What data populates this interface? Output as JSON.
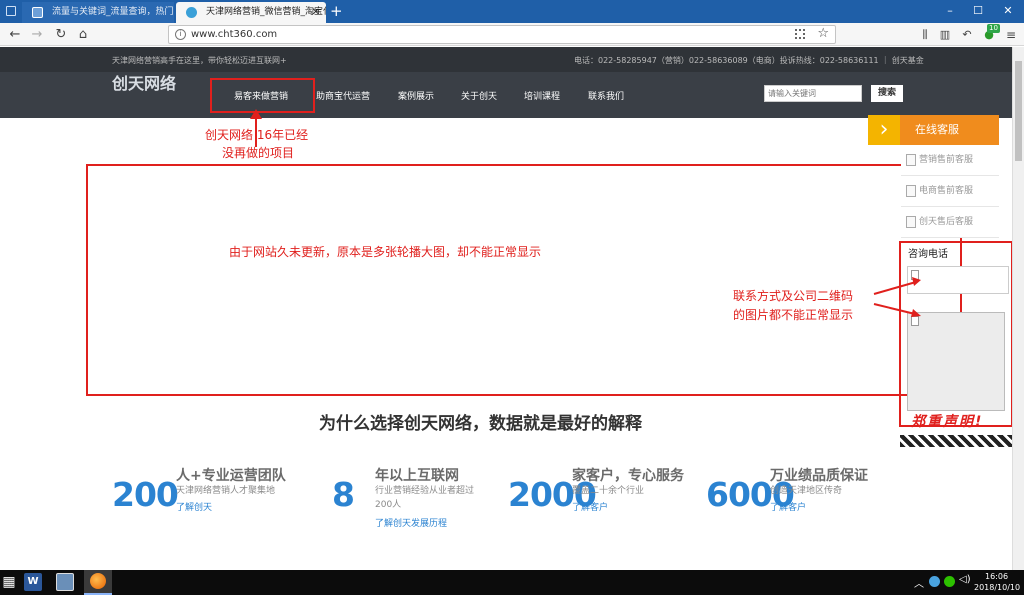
{
  "browser": {
    "tabs": [
      {
        "label": "流量与关键词_流量查询，热门"
      },
      {
        "label": "天津网络营销_微信营销_淘宝代"
      }
    ],
    "new_tab": "+",
    "window_buttons": [
      "–",
      "☐",
      "✕"
    ],
    "url": "www.cht360.com",
    "badge": "10"
  },
  "site": {
    "topbar_left": "天津网络营销高手在这里，带你轻松迈进互联网+",
    "topbar_right": "电话：022-58285947（营销）022-58636089（电商）投诉热线：022-58636111 ｜ 创天基金",
    "logo": "创天网络",
    "menu": [
      "易客来做营销",
      "助商宝代运营",
      "案例展示",
      "关于创天",
      "培训课程",
      "联系我们"
    ],
    "search_placeholder": "请输入关键词",
    "search_button": "搜索",
    "section_title": "为什么选择创天网络，数据就是最好的解释",
    "stats": [
      {
        "number": "200",
        "title": "人+专业运营团队",
        "desc": "天津网络营销人才聚集地",
        "link": "了解创天"
      },
      {
        "number": "8",
        "title": "年以上互联网",
        "desc": "行业营销经验从业者超过",
        "desc2": "200人",
        "link": "了解创天发展历程"
      },
      {
        "number": "2000",
        "title": "家客户，专心服务",
        "desc": "覆盖二十余个行业",
        "link": "了解客户"
      },
      {
        "number": "6000",
        "title": "万业绩品质保证",
        "desc": "创造天津地区传奇",
        "link": "了解客户"
      }
    ],
    "service": {
      "title": "在线客服",
      "items": [
        "营销售前客服",
        "电商售前客服",
        "创天售后客服"
      ],
      "phone_label": "咨询电话"
    }
  },
  "annotations": {
    "menu_note_line1": "创天网络 16年已经",
    "menu_note_line2": "没再做的项目",
    "banner_note": "由于网站久未更新，原本是多张轮播大图，却不能正常显示",
    "contact_note_line1": "联系方式及公司二维码",
    "contact_note_line2": "的图片都不能正常显示",
    "declaration": "郑重声明!"
  },
  "taskbar": {
    "time": "16:06",
    "date": "2018/10/10"
  },
  "colors": {
    "annotation_red": "#e0201d",
    "service_orange": "#f08c1d",
    "stat_blue": "#2b83d1",
    "header_dark": "#3a3f46"
  }
}
